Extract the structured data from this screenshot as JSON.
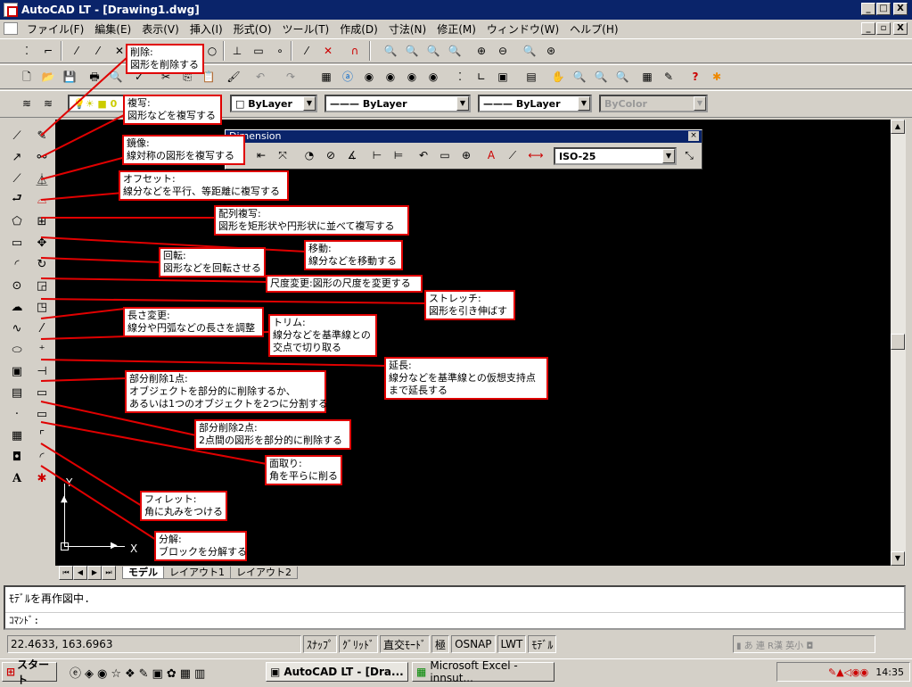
{
  "window": {
    "title": "AutoCAD LT - [Drawing1.dwg]",
    "min": "_",
    "max": "□",
    "close": "X"
  },
  "menu": [
    "ファイル(F)",
    "編集(E)",
    "表示(V)",
    "挿入(I)",
    "形式(O)",
    "ツール(T)",
    "作成(D)",
    "寸法(N)",
    "修正(M)",
    "ウィンドウ(W)",
    "ヘルプ(H)"
  ],
  "props": {
    "layer_color": "□ ByLayer",
    "linetype": "——— ByLayer",
    "lineweight": "——— ByLayer",
    "plotstyle": "ByColor"
  },
  "dimension": {
    "title": "Dimension",
    "style": "ISO-25"
  },
  "callouts": [
    {
      "title": "削除:",
      "desc": "図形を削除する"
    },
    {
      "title": "複写:",
      "desc": "図形などを複写する"
    },
    {
      "title": "鏡像:",
      "desc": "線対称の図形を複写する"
    },
    {
      "title": "オフセット:",
      "desc": "線分などを平行、等距離に複写する"
    },
    {
      "title": "配列複写:",
      "desc": "図形を矩形状や円形状に並べて複写する"
    },
    {
      "title": "移動:",
      "desc": "線分などを移動する"
    },
    {
      "title": "回転:",
      "desc": "図形などを回転させる"
    },
    {
      "title": "尺度変更:",
      "desc": "図形の尺度を変更する"
    },
    {
      "title": "ストレッチ:",
      "desc": "図形を引き伸ばす"
    },
    {
      "title": "長さ変更:",
      "desc": "線分や円弧などの長さを調整"
    },
    {
      "title": "トリム:",
      "desc": "線分などを基準線との",
      "desc2": "交点で切り取る"
    },
    {
      "title": "延長:",
      "desc": "線分などを基準線との仮想支持点",
      "desc2": "まで延長する"
    },
    {
      "title": "部分削除1点:",
      "desc": "オブジェクトを部分的に削除するか、",
      "desc2": "あるいは1つのオブジェクトを2つに分割する"
    },
    {
      "title": "部分削除2点:",
      "desc": "2点間の図形を部分的に削除する"
    },
    {
      "title": "面取り:",
      "desc": "角を平らに削る"
    },
    {
      "title": "フィレット:",
      "desc": "角に丸みをつける"
    },
    {
      "title": "分解:",
      "desc": "ブロックを分解する"
    }
  ],
  "ucs": {
    "x": "X",
    "y": "Y"
  },
  "tabs": [
    "モデル",
    "レイアウト1",
    "レイアウト2"
  ],
  "command": {
    "line1": "ﾓﾃﾞﾙを再作図中.",
    "prompt": "ｺﾏﾝﾄﾞ:"
  },
  "status": {
    "coords": "22.4633,  163.6963",
    "snap": "ｽﾅｯﾌﾟ",
    "grid": "ｸﾞﾘｯﾄﾞ",
    "ortho": "直交ﾓｰﾄﾞ",
    "polar": "極",
    "osnap": "OSNAP",
    "lwt": "LWT",
    "model": "ﾓﾃﾞﾙ"
  },
  "taskbar": {
    "start": "スタート",
    "task1": "AutoCAD LT - [Dra...",
    "task2": "Microsoft Excel - innsut...",
    "time": "14:35"
  },
  "colors": {
    "callout_border": "#e00000",
    "title": "#0a246a",
    "canvas": "#000000"
  }
}
